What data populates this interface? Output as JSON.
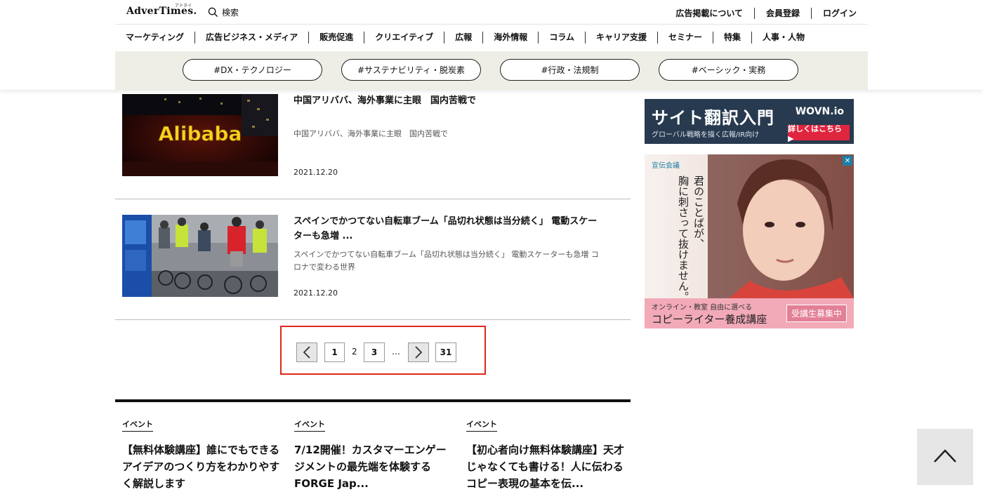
{
  "header": {
    "logo": "AdverTimes.",
    "logo_ruby": "アドタイ",
    "search_label": "検索",
    "top_links": [
      "広告掲載について",
      "会員登録",
      "ログイン"
    ],
    "nav": [
      "マーケティング",
      "広告ビジネス・メディア",
      "販売促進",
      "クリエイティブ",
      "広報",
      "海外情報",
      "コラム",
      "キャリア支援",
      "セミナー",
      "特集",
      "人事・人物"
    ],
    "tags": [
      "#DX・テクノロジー",
      "#サステナビリティ・脱炭素",
      "#行政・法規制",
      "#ベーシック・実務"
    ]
  },
  "articles": [
    {
      "title": "中国アリババ、海外事業に主眼　国内苦戦で",
      "desc": "中国アリババ、海外事業に主眼　国内苦戦で",
      "date": "2021.12.20",
      "image_text": "Alibaba"
    },
    {
      "title_line1": "スペインでかつてない自転車ブーム「品切れ状態は当分続く」 電動スケー",
      "title_line2": "ターも急増 ...",
      "desc_line1": "スペインでかつてない自転車ブーム「品切れ状態は当分続く」 電動スケーターも急増 コ",
      "desc_line2": "ロナで変わる世界",
      "date": "2021.12.20"
    }
  ],
  "pagination": {
    "items": [
      "1",
      "2",
      "3",
      "…",
      "31"
    ],
    "current": "2"
  },
  "events": [
    {
      "tag": "イベント",
      "lines": [
        "【無料体験講座】誰にでもできる",
        "アイデアのつくり方をわかりやす",
        "く解説します"
      ]
    },
    {
      "tag": "イベント",
      "lines": [
        "7/12開催！カスタマーエンゲー",
        "ジメントの最先端を体験する",
        "FORGE Jap..."
      ]
    },
    {
      "tag": "イベント",
      "lines": [
        "【初心者向け無料体験講座】天才",
        "じゃなくても書ける！人に伝わる",
        "コピー表現の基本を伝..."
      ]
    }
  ],
  "ads": {
    "wovn": {
      "title": "サイト翻訳入門",
      "brand": "WOVN.io",
      "sub": "グローバル戦略を描く広報/IR向け",
      "cta": "詳しくはこちら ▶"
    },
    "sendenkaigi": {
      "brand": "宣伝会議",
      "catch_lines": [
        "君のことばが、",
        "胸に刺さって抜けません。"
      ],
      "footer1": "オンライン・教室 自由に選べる",
      "footer2": "コピーライター養成講座",
      "badge": "受講生募集中",
      "close": "✕"
    }
  },
  "colors": {
    "highlight": "#e0261b",
    "tag_bar": "#eeeee6",
    "wovn_bg": "#273a4f",
    "ad_pink": "#f2aab9"
  }
}
